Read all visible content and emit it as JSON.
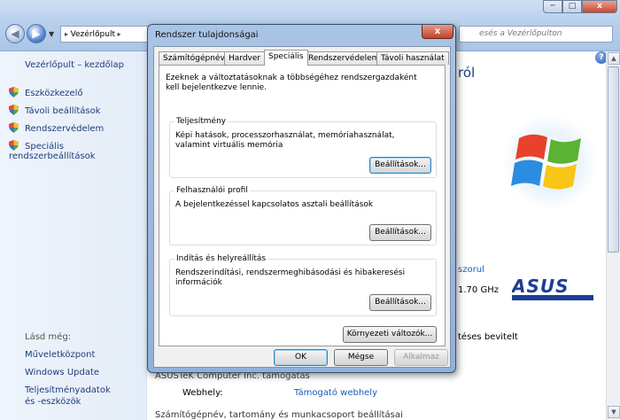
{
  "window": {
    "address": "Vezérlőpult",
    "search_placeholder": "esés a Vezérlőpulton",
    "min_label": "─",
    "max_label": "□",
    "close_label": "x"
  },
  "sidebar": {
    "home": "Vezérlőpult – kezdőlap",
    "items": [
      {
        "label": "Eszközkezelő"
      },
      {
        "label": "Távoli beállítások"
      },
      {
        "label": "Rendszervédelem"
      },
      {
        "label": "Speciális rendszerbeállítások"
      }
    ],
    "see_also": "Lásd még:",
    "links": [
      {
        "label": "Műveletközpont"
      },
      {
        "label": "Windows Update"
      },
      {
        "label": "Teljesítményadatok és -eszközök"
      }
    ]
  },
  "main": {
    "heading_fragment": "ról",
    "link_fragment": "szorul",
    "cpu_fragment": "1.70 GHz",
    "input_fragment": "téses bevitelt",
    "company_fragment": "ASUSTeK Computer Inc. támogatás",
    "website_label": "Webhely:",
    "website_link": "Támogató webhely",
    "bottom_heading": "Számítógépnév, tartomány és munkacsoport beállításai",
    "help": "?"
  },
  "dialog": {
    "title": "Rendszer tulajdonságai",
    "close": "x",
    "tabs": [
      {
        "label": "Számítógépnév"
      },
      {
        "label": "Hardver"
      },
      {
        "label": "Speciális"
      },
      {
        "label": "Rendszervédelem"
      },
      {
        "label": "Távoli használat"
      }
    ],
    "intro": "Ezeknek a változtatásoknak a többségéhez rendszergazdaként kell bejelentkezve lennie.",
    "groups": [
      {
        "legend": "Teljesítmény",
        "desc": "Képi hatások, processzorhasználat, memóriahasználat, valamint virtuális memória",
        "button": "Beállítások..."
      },
      {
        "legend": "Felhasználói profil",
        "desc": "A bejelentkezéssel kapcsolatos asztali beállítások",
        "button": "Beállítások..."
      },
      {
        "legend": "Indítás és helyreállítás",
        "desc": "Rendszerindítási, rendszermeghibásodási és hibakeresési információk",
        "button": "Beállítások..."
      }
    ],
    "env_button": "Környezeti változók...",
    "ok": "OK",
    "cancel": "Mégse",
    "apply": "Alkalmaz"
  }
}
